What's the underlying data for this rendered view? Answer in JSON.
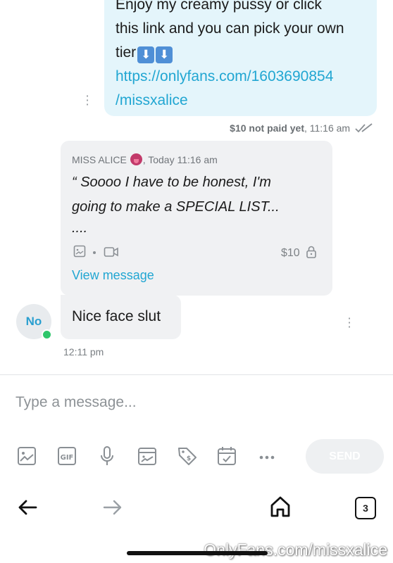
{
  "outgoing": {
    "line1": "Enjoy my creamy pussy or click",
    "line2": "this link and you can pick your own",
    "line3_prefix": "tier",
    "link_line1": "https://onlyfans.com/1603690854",
    "link_line2": "/missxalice",
    "price_status": "$10 not paid yet",
    "time": ", 11:16 am"
  },
  "quoted": {
    "sender": "MISS ALICE",
    "time": ", Today 11:16 am",
    "body_line1": "“ Soooo I have to be honest, I'm",
    "body_line2": "going to make a SPECIAL LIST...",
    "body_line3": "....",
    "price": "$10",
    "view_label": "View message"
  },
  "incoming": {
    "avatar_initials": "No",
    "text": "Nice face slut",
    "time": "12:11 pm"
  },
  "composer": {
    "placeholder": "Type a message...",
    "send_label": "SEND"
  },
  "browser": {
    "tab_count": "3"
  },
  "watermark": "OnlyFans.com/missxalice",
  "colors": {
    "accent": "#21a6d2",
    "outgoing_bubble": "#e4f5fb",
    "incoming_bubble": "#f0f1f3",
    "online": "#2fc66b"
  }
}
